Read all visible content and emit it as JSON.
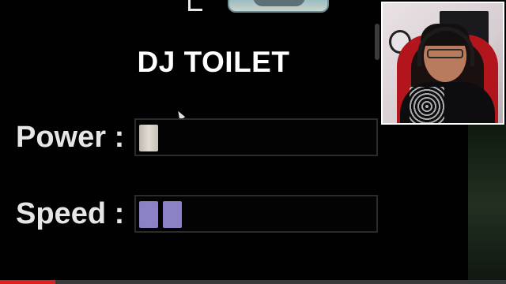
{
  "game": {
    "title": "DJ TOILET"
  },
  "stats": [
    {
      "label": "Power :",
      "filled_segments": 1,
      "color": "#d9d4ca"
    },
    {
      "label": "Speed :",
      "filled_segments": 2,
      "color": "#8a82c4"
    }
  ],
  "video": {
    "progress_fraction": 0.11,
    "progress_color": "#e01f1f"
  },
  "webcam": {
    "accent": "#b3151d"
  }
}
